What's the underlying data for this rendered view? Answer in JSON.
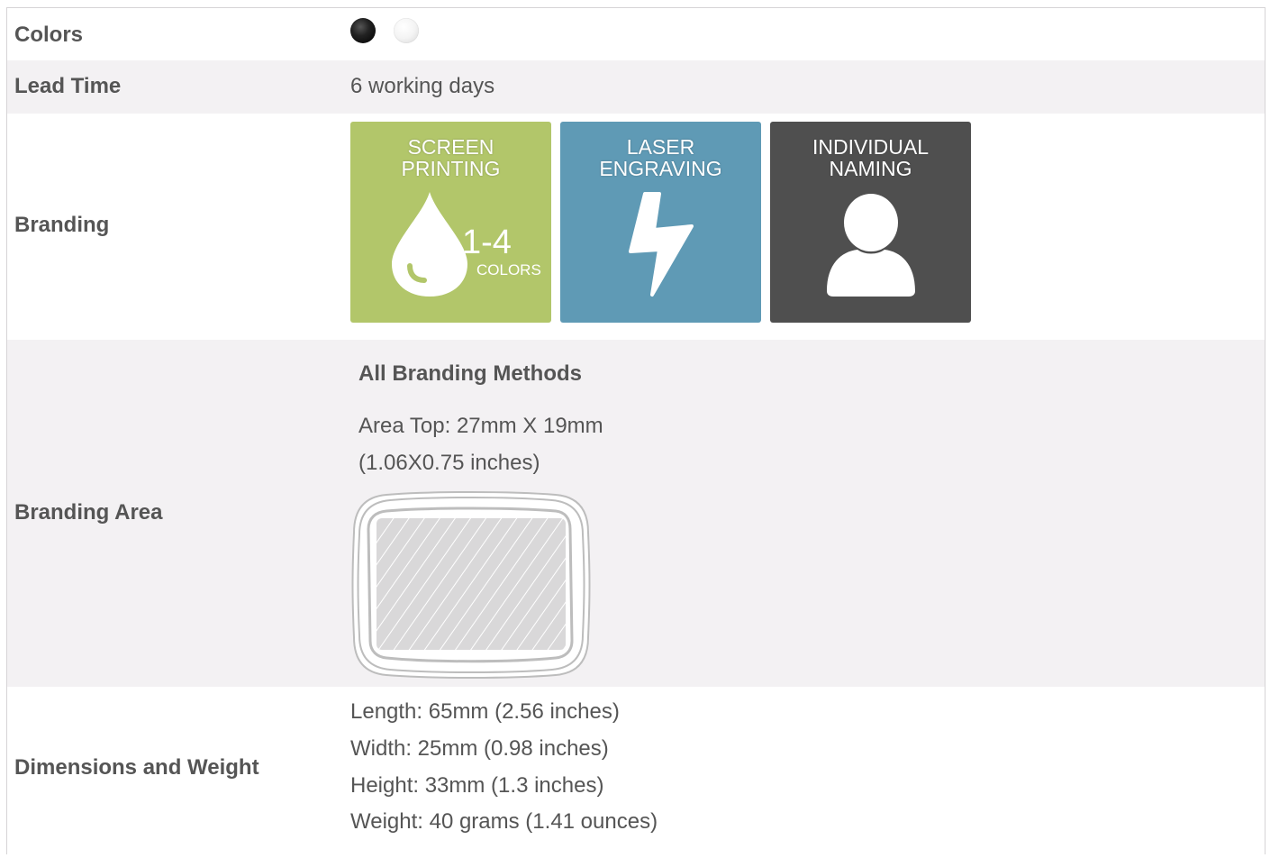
{
  "rows": {
    "colors": {
      "label": "Colors",
      "swatches": [
        {
          "name": "black",
          "color": "#111111"
        },
        {
          "name": "white",
          "color": "#f4f4f4"
        }
      ]
    },
    "lead_time": {
      "label": "Lead Time",
      "value": "6 working days"
    },
    "branding": {
      "label": "Branding",
      "tiles": [
        {
          "line1": "SCREEN",
          "line2": "PRINTING",
          "number": "1-4",
          "unit": "COLORS",
          "color": "#b2c66a",
          "icon": "ink-drop-icon"
        },
        {
          "line1": "LASER",
          "line2": "ENGRAVING",
          "color": "#5f9ab5",
          "icon": "lightning-bolt-icon"
        },
        {
          "line1": "INDIVIDUAL",
          "line2": "NAMING",
          "color": "#4f4f4f",
          "icon": "person-icon"
        }
      ]
    },
    "branding_area": {
      "label": "Branding Area",
      "heading": "All Branding Methods",
      "line1": "Area Top: 27mm X 19mm",
      "line2": "(1.06X0.75 inches)"
    },
    "dimensions": {
      "label": "Dimensions and Weight",
      "length": "Length: 65mm (2.56 inches)",
      "width": "Width: 25mm (0.98 inches)",
      "height": "Height: 33mm (1.3 inches)",
      "weight": "Weight: 40 grams (1.41 ounces)"
    }
  }
}
